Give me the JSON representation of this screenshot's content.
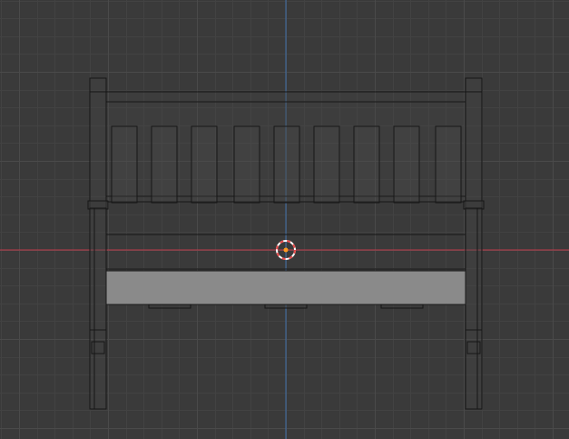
{
  "viewport": {
    "view": "front-orthographic",
    "background_color": "#3a3a3a",
    "grid": {
      "minor_color": "#424242",
      "major_color": "#4a4a4a"
    },
    "axes": {
      "x_axis_color": "#c0394b",
      "z_axis_color": "#3d6ea8"
    },
    "object": {
      "type": "bench",
      "wire_color": "#161616",
      "fill_color": "#4f4f4f",
      "selected_face_color": "#8a8a8a",
      "back_slat_count": 9
    },
    "cursor_3d": {
      "icon": "3d-cursor-icon",
      "ring_color_a": "#e94b4b",
      "ring_color_b": "#ffffff",
      "center_color": "#ff9a1f"
    }
  }
}
